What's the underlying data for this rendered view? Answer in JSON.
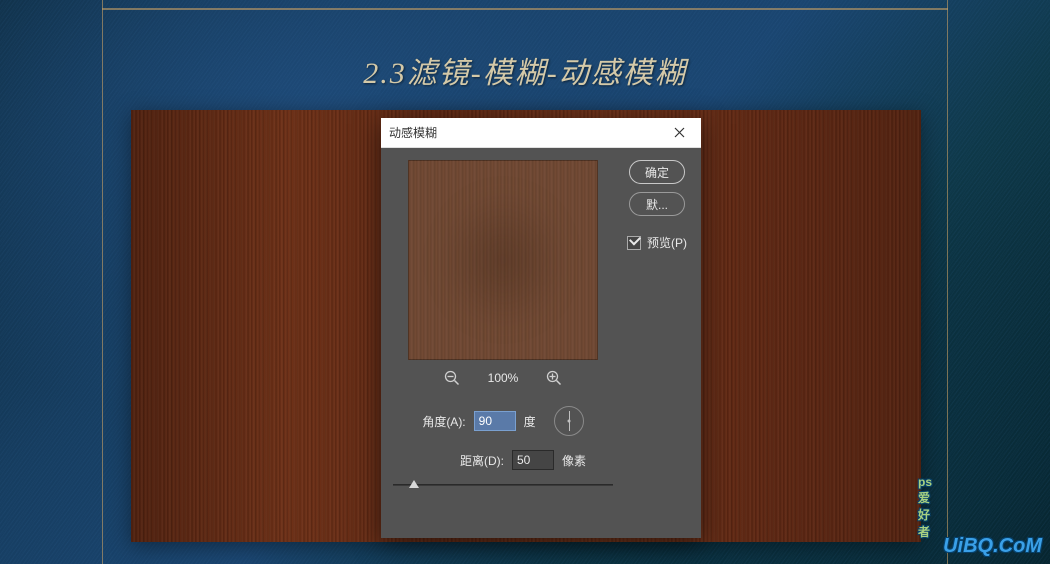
{
  "header": {
    "title": "2.3滤镜-模糊-动感模糊"
  },
  "dialog": {
    "title": "动感模糊",
    "buttons": {
      "ok": "确定",
      "cancel": "默..."
    },
    "preview_checkbox": {
      "label": "预览(P)",
      "checked": true
    },
    "zoom": {
      "value": "100%"
    },
    "angle": {
      "label": "角度(A):",
      "value": "90",
      "unit": "度"
    },
    "distance": {
      "label": "距离(D):",
      "value": "50",
      "unit": "像素"
    }
  },
  "watermark": {
    "text": "UiBQ.CoM",
    "ps": "ps爱好者"
  }
}
